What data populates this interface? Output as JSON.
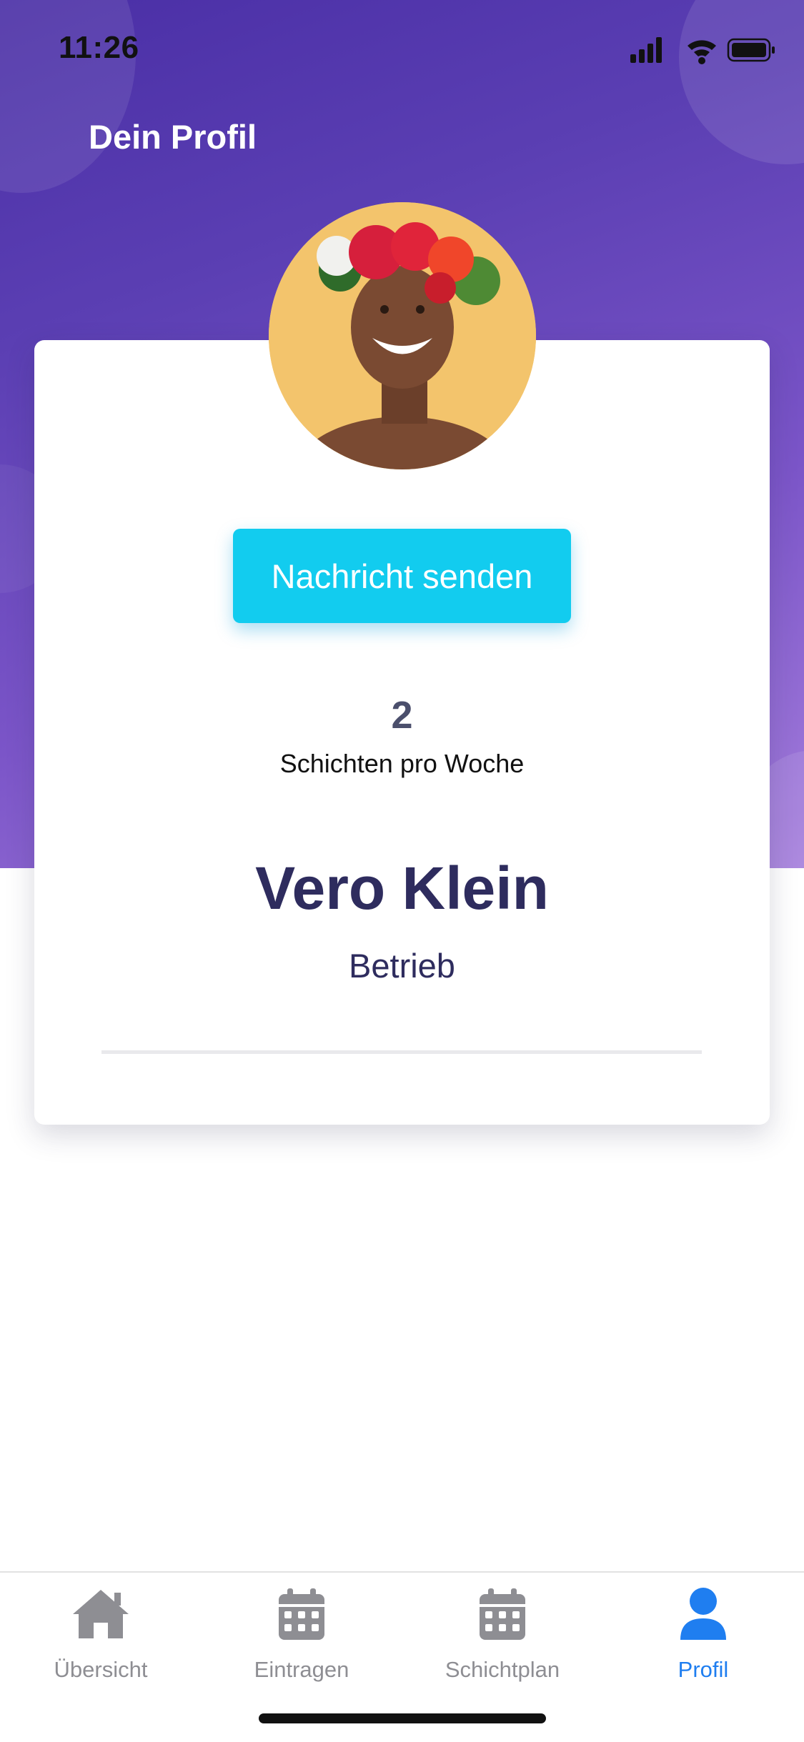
{
  "status_bar": {
    "time": "11:26",
    "icons": [
      "cellular-signal-icon",
      "wifi-icon",
      "battery-icon"
    ]
  },
  "header": {
    "title": "Dein Profil"
  },
  "profile": {
    "message_button_label": "Nachricht senden",
    "stat_value": "2",
    "stat_label": "Schichten pro Woche",
    "name": "Vero Klein",
    "role": "Betrieb"
  },
  "tabbar": {
    "items": [
      {
        "label": "Übersicht",
        "icon": "home-icon",
        "active": false
      },
      {
        "label": "Eintragen",
        "icon": "calendar-icon",
        "active": false
      },
      {
        "label": "Schichtplan",
        "icon": "calendar-icon",
        "active": false
      },
      {
        "label": "Profil",
        "icon": "person-icon",
        "active": true
      }
    ]
  },
  "colors": {
    "header_gradient_start": "#4a2fa6",
    "header_gradient_end": "#a47ddc",
    "accent_button": "#12ccef",
    "name_text": "#2e2c5e",
    "tab_active": "#1f7ef0",
    "tab_inactive": "#8e8e93"
  }
}
